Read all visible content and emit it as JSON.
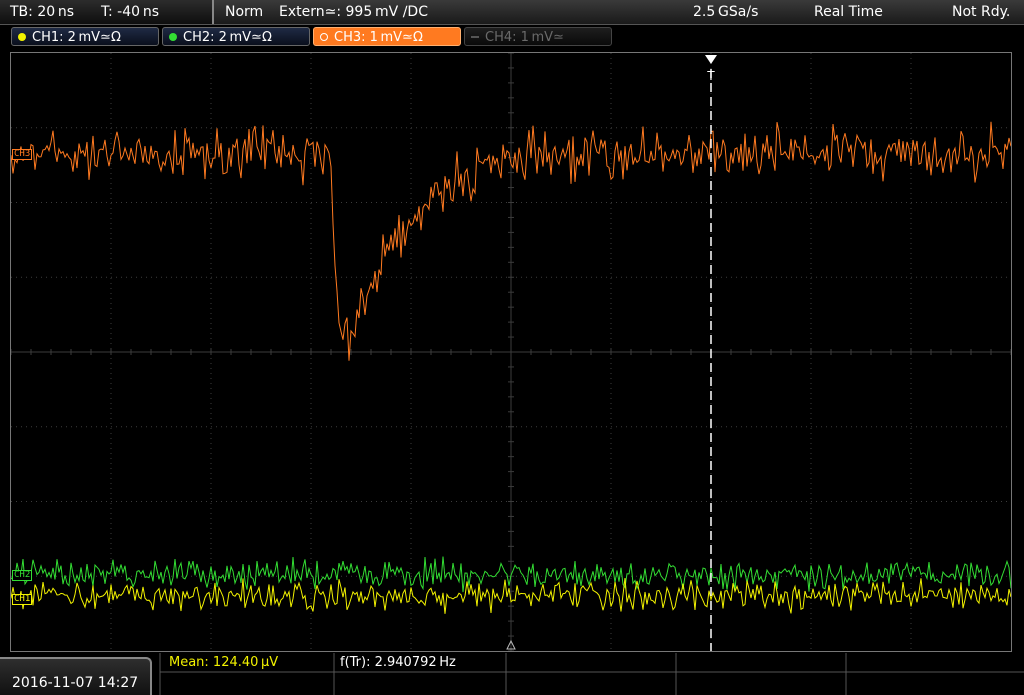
{
  "topbar": {
    "timebase": "TB: 20 ns",
    "trigger_time": "T: -40 ns",
    "trigger_mode": "Norm",
    "trigger_source": "Extern≃: 995 mV ∕DC",
    "sample_rate": "2.5 GSa/s",
    "acq_mode": "Real Time",
    "status": "Not Rdy."
  },
  "channels": [
    {
      "label": "CH1: 2 mV≃Ω",
      "color": "#f2f200",
      "state": "on"
    },
    {
      "label": "CH2: 2 mV≃Ω",
      "color": "#33dd33",
      "state": "on"
    },
    {
      "label": "CH3: 1 mV≃Ω",
      "color": "#ff7a20",
      "state": "selected"
    },
    {
      "label": "CH4: 1 mV≃",
      "color": "#555555",
      "state": "off"
    }
  ],
  "markers": {
    "ch3": "CH3",
    "ch2": "CH2",
    "ch1": "CH1",
    "trigger": "T"
  },
  "bottom": {
    "datetime": "2016-11-07 14:27",
    "mean": "Mean: 124.40 μV",
    "frequency": "f(Tr): 2.940792 Hz"
  },
  "colors": {
    "ch1": "#f2f200",
    "ch2": "#33dd33",
    "ch3": "#ff7a20",
    "grid": "#3c3c3c",
    "accent": "#ff7a20"
  }
}
